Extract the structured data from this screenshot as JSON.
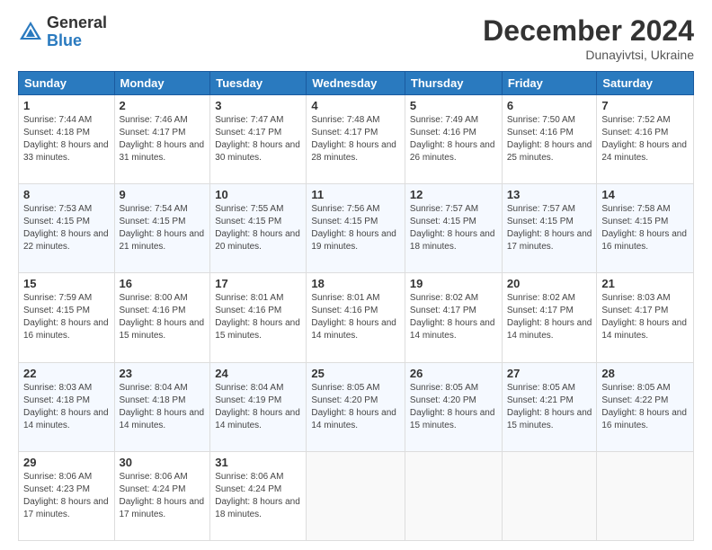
{
  "logo": {
    "general": "General",
    "blue": "Blue"
  },
  "title": "December 2024",
  "subtitle": "Dunayivtsi, Ukraine",
  "days_of_week": [
    "Sunday",
    "Monday",
    "Tuesday",
    "Wednesday",
    "Thursday",
    "Friday",
    "Saturday"
  ],
  "weeks": [
    [
      {
        "day": "1",
        "sunrise": "7:44 AM",
        "sunset": "4:18 PM",
        "daylight": "8 hours and 33 minutes."
      },
      {
        "day": "2",
        "sunrise": "7:46 AM",
        "sunset": "4:17 PM",
        "daylight": "8 hours and 31 minutes."
      },
      {
        "day": "3",
        "sunrise": "7:47 AM",
        "sunset": "4:17 PM",
        "daylight": "8 hours and 30 minutes."
      },
      {
        "day": "4",
        "sunrise": "7:48 AM",
        "sunset": "4:17 PM",
        "daylight": "8 hours and 28 minutes."
      },
      {
        "day": "5",
        "sunrise": "7:49 AM",
        "sunset": "4:16 PM",
        "daylight": "8 hours and 26 minutes."
      },
      {
        "day": "6",
        "sunrise": "7:50 AM",
        "sunset": "4:16 PM",
        "daylight": "8 hours and 25 minutes."
      },
      {
        "day": "7",
        "sunrise": "7:52 AM",
        "sunset": "4:16 PM",
        "daylight": "8 hours and 24 minutes."
      }
    ],
    [
      {
        "day": "8",
        "sunrise": "7:53 AM",
        "sunset": "4:15 PM",
        "daylight": "8 hours and 22 minutes."
      },
      {
        "day": "9",
        "sunrise": "7:54 AM",
        "sunset": "4:15 PM",
        "daylight": "8 hours and 21 minutes."
      },
      {
        "day": "10",
        "sunrise": "7:55 AM",
        "sunset": "4:15 PM",
        "daylight": "8 hours and 20 minutes."
      },
      {
        "day": "11",
        "sunrise": "7:56 AM",
        "sunset": "4:15 PM",
        "daylight": "8 hours and 19 minutes."
      },
      {
        "day": "12",
        "sunrise": "7:57 AM",
        "sunset": "4:15 PM",
        "daylight": "8 hours and 18 minutes."
      },
      {
        "day": "13",
        "sunrise": "7:57 AM",
        "sunset": "4:15 PM",
        "daylight": "8 hours and 17 minutes."
      },
      {
        "day": "14",
        "sunrise": "7:58 AM",
        "sunset": "4:15 PM",
        "daylight": "8 hours and 16 minutes."
      }
    ],
    [
      {
        "day": "15",
        "sunrise": "7:59 AM",
        "sunset": "4:15 PM",
        "daylight": "8 hours and 16 minutes."
      },
      {
        "day": "16",
        "sunrise": "8:00 AM",
        "sunset": "4:16 PM",
        "daylight": "8 hours and 15 minutes."
      },
      {
        "day": "17",
        "sunrise": "8:01 AM",
        "sunset": "4:16 PM",
        "daylight": "8 hours and 15 minutes."
      },
      {
        "day": "18",
        "sunrise": "8:01 AM",
        "sunset": "4:16 PM",
        "daylight": "8 hours and 14 minutes."
      },
      {
        "day": "19",
        "sunrise": "8:02 AM",
        "sunset": "4:17 PM",
        "daylight": "8 hours and 14 minutes."
      },
      {
        "day": "20",
        "sunrise": "8:02 AM",
        "sunset": "4:17 PM",
        "daylight": "8 hours and 14 minutes."
      },
      {
        "day": "21",
        "sunrise": "8:03 AM",
        "sunset": "4:17 PM",
        "daylight": "8 hours and 14 minutes."
      }
    ],
    [
      {
        "day": "22",
        "sunrise": "8:03 AM",
        "sunset": "4:18 PM",
        "daylight": "8 hours and 14 minutes."
      },
      {
        "day": "23",
        "sunrise": "8:04 AM",
        "sunset": "4:18 PM",
        "daylight": "8 hours and 14 minutes."
      },
      {
        "day": "24",
        "sunrise": "8:04 AM",
        "sunset": "4:19 PM",
        "daylight": "8 hours and 14 minutes."
      },
      {
        "day": "25",
        "sunrise": "8:05 AM",
        "sunset": "4:20 PM",
        "daylight": "8 hours and 14 minutes."
      },
      {
        "day": "26",
        "sunrise": "8:05 AM",
        "sunset": "4:20 PM",
        "daylight": "8 hours and 15 minutes."
      },
      {
        "day": "27",
        "sunrise": "8:05 AM",
        "sunset": "4:21 PM",
        "daylight": "8 hours and 15 minutes."
      },
      {
        "day": "28",
        "sunrise": "8:05 AM",
        "sunset": "4:22 PM",
        "daylight": "8 hours and 16 minutes."
      }
    ],
    [
      {
        "day": "29",
        "sunrise": "8:06 AM",
        "sunset": "4:23 PM",
        "daylight": "8 hours and 17 minutes."
      },
      {
        "day": "30",
        "sunrise": "8:06 AM",
        "sunset": "4:24 PM",
        "daylight": "8 hours and 17 minutes."
      },
      {
        "day": "31",
        "sunrise": "8:06 AM",
        "sunset": "4:24 PM",
        "daylight": "8 hours and 18 minutes."
      },
      null,
      null,
      null,
      null
    ]
  ],
  "labels": {
    "sunrise": "Sunrise:",
    "sunset": "Sunset:",
    "daylight": "Daylight:"
  }
}
